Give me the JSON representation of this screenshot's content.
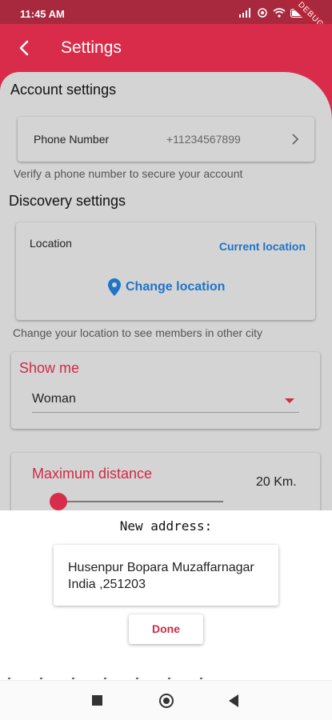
{
  "status_bar": {
    "time": "11:45 AM",
    "debug_label": "DEBUG"
  },
  "app_bar": {
    "title": "Settings"
  },
  "account": {
    "title": "Account settings",
    "phone_label": "Phone Number",
    "phone_value": "+11234567899",
    "helper": "Verify a phone number to secure your account"
  },
  "discovery": {
    "title": "Discovery settings",
    "location_label": "Location",
    "current_location": "Current location",
    "change_location": "Change location",
    "helper": "Change your location to see members in other city"
  },
  "show_me": {
    "title": "Show me",
    "value": "Woman"
  },
  "max_distance": {
    "title": "Maximum distance",
    "value": "20 Km.",
    "slider_fraction": 0.0
  },
  "dialog": {
    "title": "New address:",
    "address": "Husenpur Bopara Muzaffarnagar India ,251203",
    "done": "Done"
  },
  "colors": {
    "primary": "#d82c4a",
    "link": "#1e74c8",
    "status_bar": "#a8293d"
  }
}
